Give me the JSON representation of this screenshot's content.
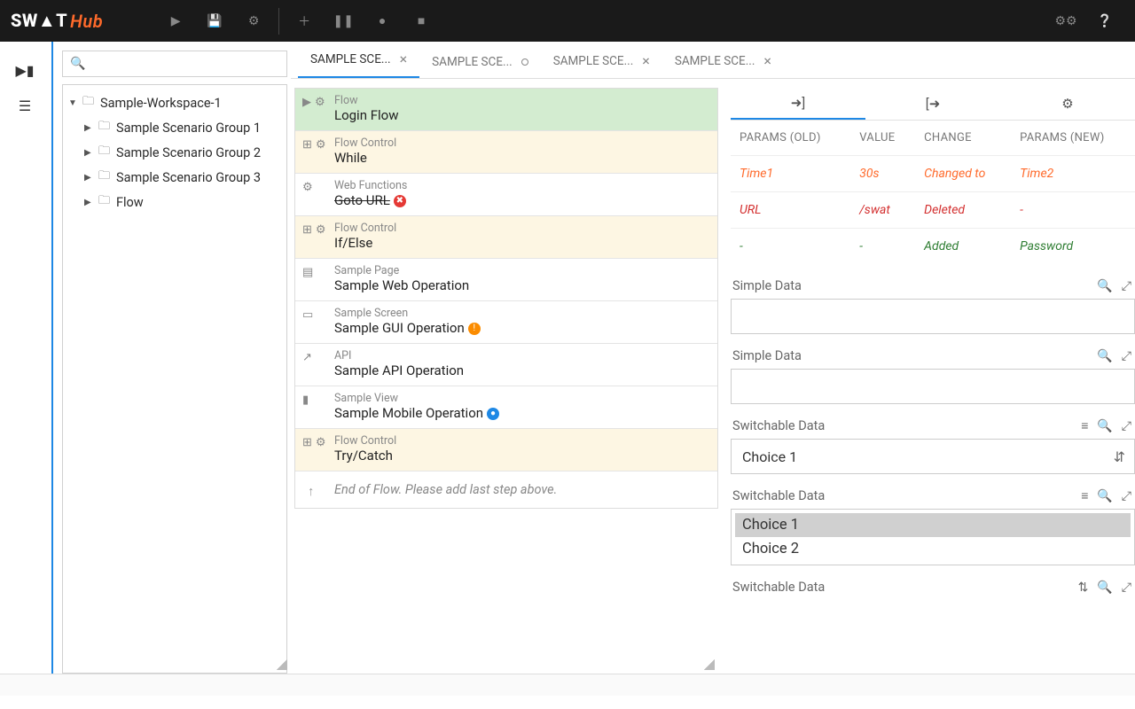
{
  "brand": {
    "sw": "SW▲T",
    "hub": "Hub"
  },
  "sidebar": {
    "workspace": "Sample-Workspace-1",
    "items": [
      "Sample Scenario Group 1",
      "Sample Scenario Group 2",
      "Sample Scenario Group 3",
      "Flow"
    ]
  },
  "tabs": [
    {
      "label": "SAMPLE SCE...",
      "active": true,
      "close": "x"
    },
    {
      "label": "SAMPLE SCE...",
      "active": false,
      "close": "o"
    },
    {
      "label": "SAMPLE SCE...",
      "active": false,
      "close": "x"
    },
    {
      "label": "SAMPLE SCE...",
      "active": false,
      "close": "x"
    }
  ],
  "steps": [
    {
      "cat": "Flow",
      "title": "Login Flow",
      "kind": "sel",
      "icons": [
        "▶",
        "⚙"
      ]
    },
    {
      "cat": "Flow Control",
      "title": "While",
      "kind": "fc",
      "icons": [
        "⊞",
        "⚙"
      ]
    },
    {
      "cat": "Web Functions",
      "title": "Goto URL",
      "kind": "plain",
      "icons": [
        "⚙"
      ],
      "strike": true,
      "badge": "red"
    },
    {
      "cat": "Flow Control",
      "title": "If/Else",
      "kind": "fc",
      "icons": [
        "⊞",
        "⚙"
      ]
    },
    {
      "cat": "Sample Page",
      "title": "Sample Web Operation",
      "kind": "plain",
      "icons": [
        "▤"
      ]
    },
    {
      "cat": "Sample Screen",
      "title": "Sample GUI Operation",
      "kind": "plain",
      "icons": [
        "▭"
      ],
      "badge": "orange"
    },
    {
      "cat": "API",
      "title": "Sample API Operation",
      "kind": "plain",
      "icons": [
        "↗"
      ]
    },
    {
      "cat": "Sample View",
      "title": "Sample Mobile Operation",
      "kind": "plain",
      "icons": [
        "▮"
      ],
      "badge": "blue"
    },
    {
      "cat": "Flow Control",
      "title": "Try/Catch",
      "kind": "fc",
      "icons": [
        "⊞",
        "⚙"
      ]
    }
  ],
  "eof": "End of Flow. Please add last step above.",
  "params": {
    "headers": [
      "PARAMS (OLD)",
      "VALUE",
      "CHANGE",
      "PARAMS (NEW)"
    ],
    "rows": [
      {
        "cls": "row-orange",
        "cells": [
          "Time1",
          "30s",
          "Changed to",
          "Time2"
        ]
      },
      {
        "cls": "row-red",
        "cells": [
          "URL",
          "/swat",
          "Deleted",
          "-"
        ]
      },
      {
        "cls": "row-green",
        "cells": [
          "-",
          "-",
          "Added",
          "Password"
        ]
      }
    ]
  },
  "data_sections": [
    {
      "label": "Simple Data",
      "type": "box",
      "icons": [
        "🔍",
        "⤢"
      ]
    },
    {
      "label": "Simple Data",
      "type": "box",
      "icons": [
        "🔍",
        "⤢"
      ]
    },
    {
      "label": "Switchable Data",
      "type": "select",
      "value": "Choice 1",
      "icons": [
        "≡",
        "🔍",
        "⤢"
      ]
    },
    {
      "label": "Switchable Data",
      "type": "list",
      "options": [
        "Choice 1",
        "Choice 2"
      ],
      "selected": 0,
      "icons": [
        "≡",
        "🔍",
        "⤢"
      ]
    },
    {
      "label": "Switchable Data",
      "type": "none",
      "icons": [
        "⇅",
        "🔍",
        "⤢"
      ]
    }
  ]
}
